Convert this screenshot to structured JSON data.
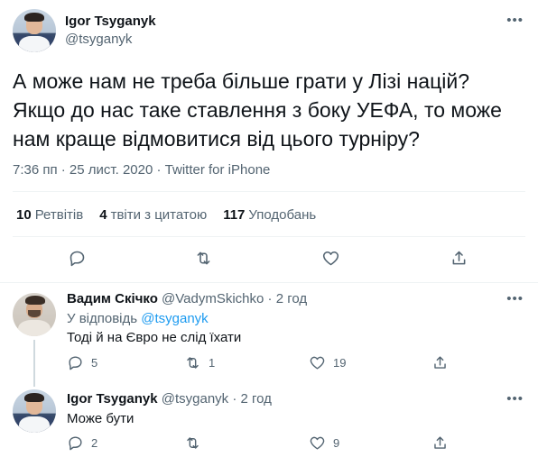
{
  "main_tweet": {
    "author_name": "Igor Tsyganyk",
    "author_handle": "@tsyganyk",
    "text": "А може нам не треба більше грати у Лізі націй? Якщо до нас таке ставлення з боку УЕФА, то може нам краще відмовитися від цього турніру?",
    "timestamp": "7:36 пп · 25 лист. 2020 · Twitter for iPhone",
    "more_icon": "more-icon",
    "stats": {
      "retweets_count": "10",
      "retweets_label": "Ретвітів",
      "quotes_count": "4",
      "quotes_label": "твіти з цитатою",
      "likes_count": "117",
      "likes_label": "Уподобань"
    },
    "actions": [
      "reply-icon",
      "retweet-icon",
      "like-icon",
      "share-icon"
    ]
  },
  "replies": [
    {
      "author_name": "Вадим Скічко",
      "author_handle": "@VadymSkichko",
      "time": "· 2 год",
      "reply_to_label": "У відповідь",
      "reply_to_handle": "@tsyganyk",
      "text": "Тоді й на Євро не слід їхати",
      "reply_count": "5",
      "retweet_count": "1",
      "like_count": "19"
    },
    {
      "author_name": "Igor Tsyganyk",
      "author_handle": "@tsyganyk",
      "time": "· 2 год",
      "text": "Може бути",
      "reply_count": "2",
      "retweet_count": "",
      "like_count": "9"
    }
  ],
  "colors": {
    "text_primary": "#0f1419",
    "text_secondary": "#536471",
    "link": "#1d9bf0",
    "divider": "#eff3f4"
  }
}
